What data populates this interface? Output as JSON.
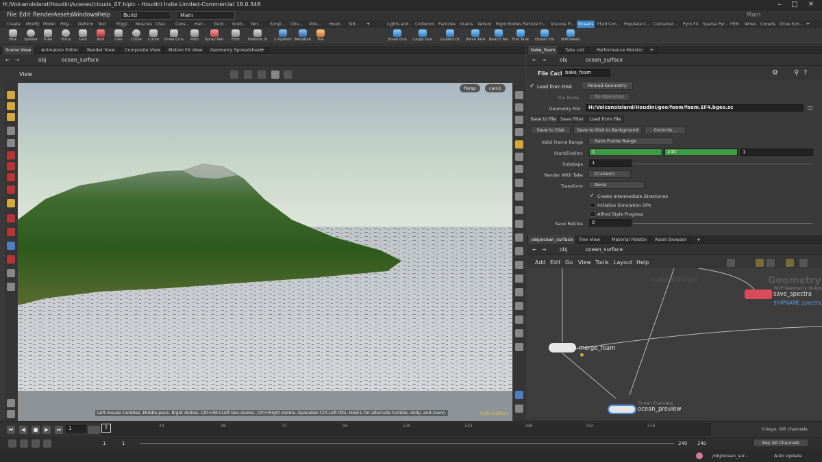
{
  "window": {
    "title": "H:/VolcanoIsland/Houdini/scenes/clouds_07.hiplc - Houdini Indie Limited-Commercial 18.0.348"
  },
  "menu": [
    "File",
    "Edit",
    "Render",
    "Assets",
    "Windows",
    "Help"
  ],
  "desktop_build": "Build",
  "desktop_main": "Main",
  "main_right": "Main",
  "shelf_tabs_left": [
    "Create",
    "Modify",
    "Model",
    "Poly...",
    "Deform",
    "Text",
    "Riggi...",
    "Muscles",
    "Char...",
    "Cons...",
    "Hair...",
    "Guid...",
    "Guid...",
    "Terr...",
    "Simpl...",
    "Clou...",
    "Volu...",
    "Houd...",
    "Sid..."
  ],
  "shelf_tabs_right": [
    "Lights and...",
    "Collisions",
    "Particles",
    "Grains",
    "Vellum",
    "Rigid Bodies",
    "Particle Fl...",
    "Viscous Fl...",
    "Oceans",
    "Fluid Con...",
    "Populate C...",
    "Container...",
    "Pyro FX",
    "Sparse Pyr...",
    "FEM",
    "Wires",
    "Crowds",
    "Drive Sim..."
  ],
  "shelf_tools_left": [
    "Box",
    "Sphere",
    "Tube",
    "Torus",
    "Grid",
    "Null",
    "Line",
    "Circle",
    "Curve",
    "Draw Curve",
    "Path",
    "Spray Paint",
    "Font",
    "Platonic Solids",
    "L-System",
    "Metaball",
    "File"
  ],
  "shelf_tools_right": [
    "Small Ocean",
    "Large Ocean",
    "Guided Ocean Layer",
    "Wave Tank",
    "Beach Tank",
    "Flat Tank",
    "Ocean Flat Tank",
    "Whitewater"
  ],
  "left_pane": {
    "tabs": [
      "Scene View",
      "Animation Editor",
      "Render View",
      "Composite View",
      "Motion FX View",
      "Geometry Spreadsheet"
    ],
    "path_root": "obj",
    "path_node": "ocean_surface",
    "view_label": "View",
    "persp": "Persp",
    "cam": "cam1",
    "hint": "Left mouse tumbles. Middle pans. Right dollies. Ctrl+Alt+Left box-zooms. Ctrl+Right zooms. Spacebar-Ctrl-Left tilts. Hold L for alternate tumble, dolly, and zoom.",
    "edition": "Indie Edition"
  },
  "params": {
    "tabs": [
      "bake_foam",
      "Take List",
      "Performance Monitor"
    ],
    "path_root": "obj",
    "path_node": "ocean_surface",
    "node_type": "File Cache",
    "node_name": "bake_foam",
    "load_from_disk": "Load from Disk",
    "reload": "Reload Geometry",
    "file_mode_label": "File Mode",
    "file_mode": "No Operation",
    "geo_file_label": "Geometry File",
    "geo_file": "H:/VolcanoIsland/Houdini/geo/foam/foam.$F4.bgeo.sc",
    "subtabs": [
      "Save to File",
      "Save Filter",
      "Load from File"
    ],
    "save_disk": "Save to Disk",
    "save_bg": "Save to Disk in Background",
    "controls": "Controls...",
    "vfr_label": "Valid Frame Range",
    "vfr": "Save Frame Range",
    "sei_label": "Start/End/Inc",
    "start": "1",
    "end": "240",
    "inc": "1",
    "substeps_label": "Substeps",
    "substeps": "1",
    "rwt_label": "Render With Take",
    "rwt": "(Current)",
    "transform_label": "Transform",
    "transform": "None",
    "cid": "Create Intermediate Directories",
    "init_sim": "Initialize Simulation OPs",
    "alfred": "Alfred Style Progress",
    "retries_label": "Save Retries",
    "retries": "0"
  },
  "network": {
    "tabs": [
      "/obj/ocean_surface",
      "Tree View",
      "Material Palette",
      "Asset Browser"
    ],
    "path_root": "obj",
    "path_node": "ocean_surface",
    "menu": [
      "Add",
      "Edit",
      "Go",
      "View",
      "Tools",
      "Layout",
      "Help"
    ],
    "watermark": "Indie Edition",
    "geometry_label": "Geometry",
    "rop_label": "ROP Geometry Output",
    "save_spectra": "save_spectra",
    "shipname": "$HIPNAME.spectra.b",
    "merge_foam": "merge_foam",
    "ocean_eval": "Ocean Evaluate",
    "ocean_preview": "ocean_preview"
  },
  "timeline": {
    "frame": "1",
    "ticks": [
      "24",
      "48",
      "72",
      "96",
      "120",
      "144",
      "168",
      "192",
      "216"
    ],
    "first_tick": "1",
    "keys": "0 keys, 0/0 channels",
    "key_all": "Key All Channels",
    "start": "1",
    "start2": "1",
    "end": "240",
    "end2": "240"
  },
  "status": {
    "path": "/obj/ocean_sur...",
    "mode": "Auto Update"
  }
}
